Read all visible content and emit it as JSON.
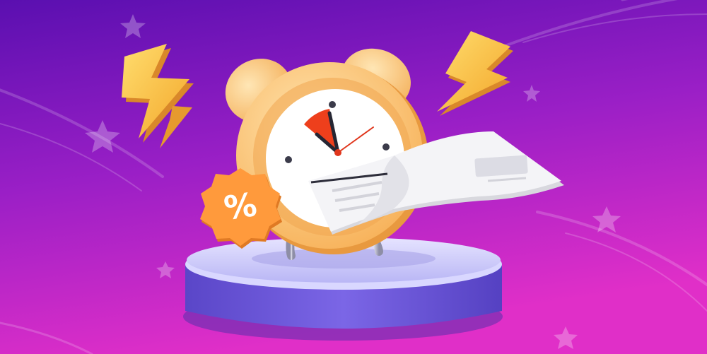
{
  "badge": {
    "symbol": "%"
  },
  "colors": {
    "background_top": "#6a12b8",
    "background_bottom": "#d92bc9",
    "clock_body": "#ffc97a",
    "clock_face": "#ffffff",
    "timer_wedge": "#ee3f1c",
    "lightning": "#ffcb4a",
    "badge": "#ff9a3c",
    "podium_top": "#c9c7ff",
    "podium_side": "#6b56d9",
    "receipt": "#f2f2f4"
  },
  "icons": [
    "alarm-clock-icon",
    "lightning-bolt-icon",
    "percent-badge-icon",
    "receipt-icon",
    "star-icon"
  ]
}
